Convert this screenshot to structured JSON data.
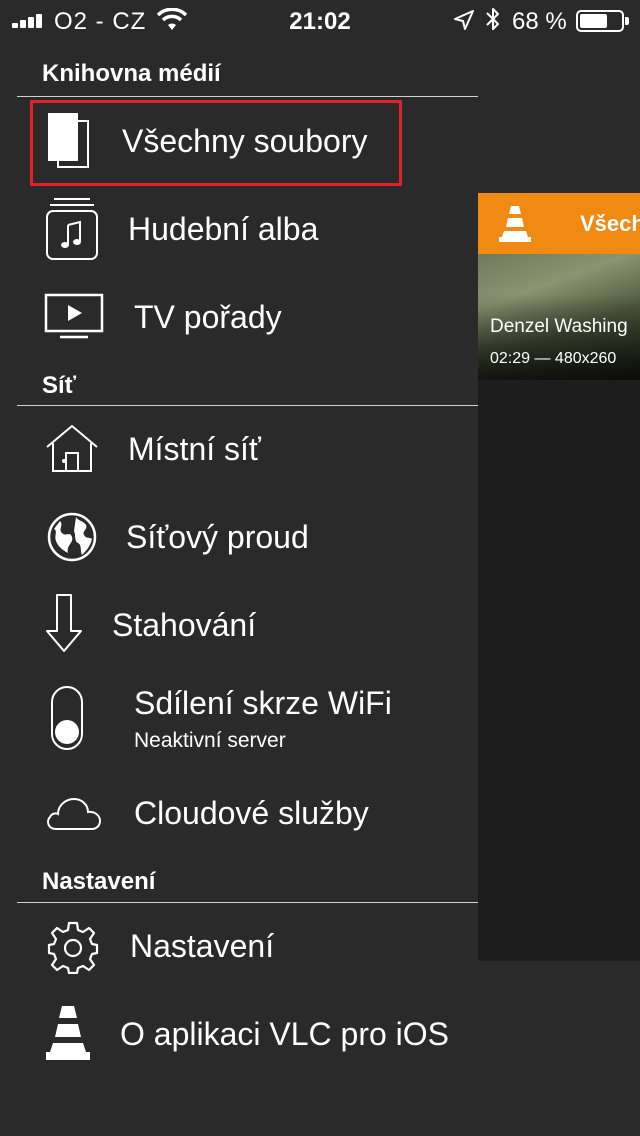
{
  "status_bar": {
    "carrier": "O2 - CZ",
    "time": "21:02",
    "battery_percent": "68 %",
    "battery_level": 0.68,
    "icons": [
      "signal-icon",
      "wifi-icon",
      "location-icon",
      "bluetooth-icon",
      "battery-icon"
    ]
  },
  "menu": {
    "sections": [
      {
        "header": "Knihovna médií",
        "items": [
          {
            "label": "Všechny soubory",
            "icon": "files-icon",
            "selected": true
          },
          {
            "label": "Hudební alba",
            "icon": "music-album-icon"
          },
          {
            "label": "TV pořady",
            "icon": "tv-icon"
          }
        ]
      },
      {
        "header": "Síť",
        "items": [
          {
            "label": "Místní síť",
            "icon": "home-network-icon"
          },
          {
            "label": "Síťový proud",
            "icon": "globe-icon"
          },
          {
            "label": "Stahování",
            "icon": "download-arrow-icon"
          },
          {
            "label": "Sdílení skrze WiFi",
            "sublabel": "Neaktivní server",
            "icon": "toggle-icon"
          },
          {
            "label": "Cloudové služby",
            "icon": "cloud-icon"
          }
        ]
      },
      {
        "header": "Nastavení",
        "items": [
          {
            "label": "Nastavení",
            "icon": "gear-icon"
          },
          {
            "label": "O aplikaci VLC pro iOS",
            "icon": "vlc-cone-icon"
          }
        ]
      }
    ]
  },
  "content": {
    "nav_title": "Všech",
    "video": {
      "title": "Denzel Washing",
      "meta": "02:29 — 480x260"
    }
  },
  "colors": {
    "background": "#2a2a2a",
    "accent_orange": "#f08a13",
    "selection_border": "#e0202a"
  }
}
